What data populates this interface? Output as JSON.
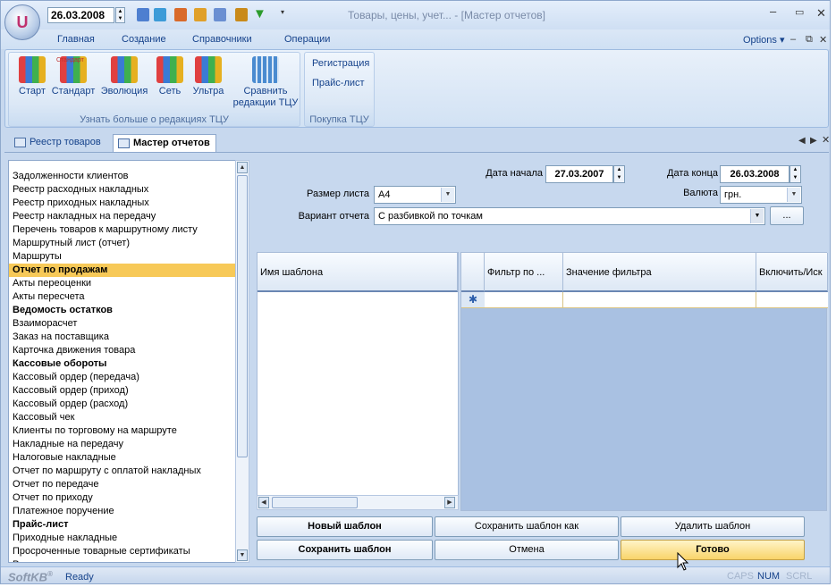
{
  "app": {
    "title": "Товары, цены, учет... - [Мастер отчетов]",
    "logo": "U",
    "date": "26.03.2008"
  },
  "menu": {
    "items": [
      "Главная",
      "Создание",
      "Справочники",
      "Операции"
    ],
    "options": "Options"
  },
  "ribbon": {
    "group1": {
      "label": "Узнать больше о редакциях ТЦУ",
      "buttons": [
        "Старт",
        "Стандарт",
        "Эволюция",
        "Сеть",
        "Ультра",
        "Сравнить",
        "редакции ТЦУ"
      ],
      "badge": "Стандарт"
    },
    "group2": {
      "label": "Покупка ТЦУ",
      "links": [
        "Регистрация",
        "Прайс-лист"
      ]
    }
  },
  "doc_tabs": {
    "registry": "Реестр товаров",
    "wizard": "Мастер отчетов"
  },
  "reports": [
    {
      "label": "Задолженности клиентов",
      "style": "normal"
    },
    {
      "label": "Реестр расходных накладных",
      "style": "normal"
    },
    {
      "label": "Реестр приходных накладных",
      "style": "normal"
    },
    {
      "label": "Реестр накладных на передачу",
      "style": "normal"
    },
    {
      "label": "Перечень товаров к маршрутному листу",
      "style": "normal"
    },
    {
      "label": "Маршрутный лист (отчет)",
      "style": "normal"
    },
    {
      "label": "Маршруты",
      "style": "normal"
    },
    {
      "label": "Отчет по продажам",
      "style": "selected"
    },
    {
      "label": "Акты переоценки",
      "style": "normal"
    },
    {
      "label": "Акты пересчета",
      "style": "normal"
    },
    {
      "label": "Ведомость остатков",
      "style": "bold"
    },
    {
      "label": "Взаиморасчет",
      "style": "normal"
    },
    {
      "label": "Заказ на поставщика",
      "style": "normal"
    },
    {
      "label": "Карточка движения товара",
      "style": "normal"
    },
    {
      "label": "Кассовые обороты",
      "style": "bold"
    },
    {
      "label": "Кассовый ордер (передача)",
      "style": "normal"
    },
    {
      "label": "Кассовый ордер (приход)",
      "style": "normal"
    },
    {
      "label": "Кассовый ордер (расход)",
      "style": "normal"
    },
    {
      "label": "Кассовый чек",
      "style": "normal"
    },
    {
      "label": "Клиенты по торговому на маршруте",
      "style": "normal"
    },
    {
      "label": "Накладные на передачу",
      "style": "normal"
    },
    {
      "label": "Налоговые накладные",
      "style": "normal"
    },
    {
      "label": "Отчет по маршруту с оплатой накладных",
      "style": "normal"
    },
    {
      "label": "Отчет по передаче",
      "style": "normal"
    },
    {
      "label": "Отчет по приходу",
      "style": "normal"
    },
    {
      "label": "Платежное поручение",
      "style": "normal"
    },
    {
      "label": "Прайс-лист",
      "style": "bold"
    },
    {
      "label": "Приходные накладные",
      "style": "normal"
    },
    {
      "label": "Просроченные товарные сертификаты",
      "style": "normal"
    },
    {
      "label": "Расходные накладные",
      "style": "normal"
    }
  ],
  "form": {
    "date_start_label": "Дата начала",
    "date_start": "27.03.2007",
    "date_end_label": "Дата конца",
    "date_end": "26.03.2008",
    "sheet_label": "Размер листа",
    "sheet": "A4",
    "currency_label": "Валюта",
    "currency": "грн.",
    "variant_label": "Вариант отчета",
    "variant": "С разбивкой по точкам",
    "browse": "..."
  },
  "templates_grid": {
    "header": "Имя шаблона"
  },
  "filters_grid": {
    "headers": [
      "Фильтр по ...",
      "Значение фильтра",
      "Включить/Иск"
    ],
    "new_row_mark": "✱"
  },
  "buttons": {
    "new_template": "Новый шаблон",
    "save_as": "Сохранить шаблон как",
    "delete": "Удалить шаблон",
    "save": "Сохранить шаблон",
    "cancel": "Отмена",
    "done": "Готово"
  },
  "status": {
    "brand": "SoftKB",
    "reg": "®",
    "text": "Ready",
    "indicators": [
      "CAPS",
      "NUM",
      "SCRL"
    ]
  }
}
